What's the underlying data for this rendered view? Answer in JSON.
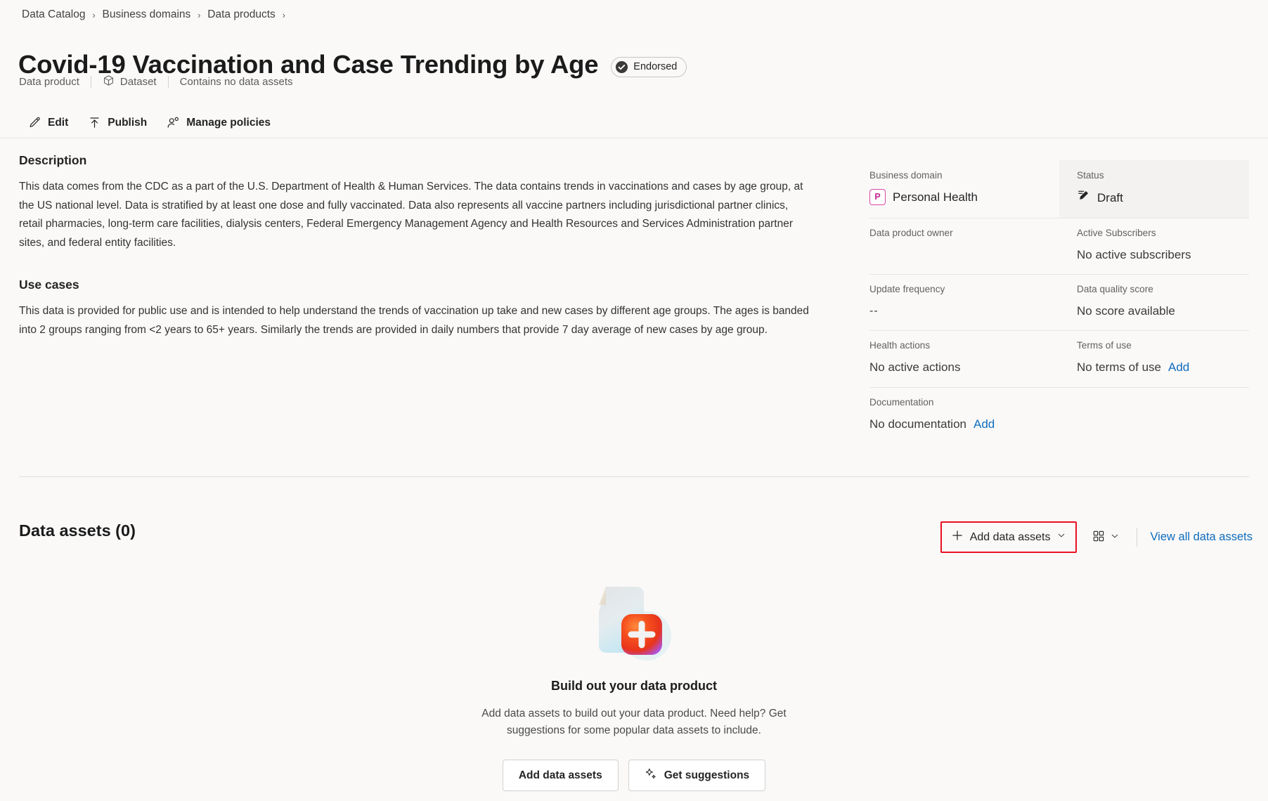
{
  "breadcrumb": {
    "items": [
      {
        "label": "Data Catalog"
      },
      {
        "label": "Business domains"
      },
      {
        "label": "Data products"
      }
    ],
    "separator": "›"
  },
  "header": {
    "title": "Covid-19 Vaccination and Case Trending by Age",
    "endorsed_label": "Endorsed",
    "endorsed_icon": "check-circle-icon",
    "subtitle": {
      "type": "Data product",
      "kind": "Dataset",
      "kind_icon": "cube-icon",
      "assets_status": "Contains no data assets"
    }
  },
  "commandbar": {
    "edit": {
      "label": "Edit",
      "icon": "pencil-icon"
    },
    "publish": {
      "label": "Publish",
      "icon": "upload-arrow-icon"
    },
    "manage_policies": {
      "label": "Manage policies",
      "icon": "person-settings-icon"
    }
  },
  "description": {
    "heading": "Description",
    "body": "This data comes from the CDC as a part of the U.S. Department of Health & Human Services.  The data contains trends in vaccinations and cases by age group, at the US national level. Data is stratified by at least one dose and fully vaccinated. Data also represents all vaccine partners including jurisdictional partner clinics, retail pharmacies, long-term care facilities, dialysis centers, Federal Emergency Management Agency and Health Resources and Services Administration partner sites, and federal entity facilities."
  },
  "use_cases": {
    "heading": "Use cases",
    "body": "This data is provided for public use and is intended to help understand the trends of vaccination up take and new cases by different age groups.  The ages is banded into 2 groups ranging from <2 years to 65+ years.  Similarly the trends are provided in daily numbers that provide 7 day average of new cases by age group."
  },
  "properties": {
    "business_domain": {
      "label": "Business domain",
      "value": "Personal Health",
      "chip": "P",
      "chip_color": "#c2298f"
    },
    "status": {
      "label": "Status",
      "value": "Draft",
      "icon": "edit-filled-icon",
      "highlight_color": "#f3f2f1"
    },
    "data_product_owner": {
      "label": "Data product owner",
      "value": ""
    },
    "active_subscribers": {
      "label": "Active Subscribers",
      "value": "No active subscribers"
    },
    "update_frequency": {
      "label": "Update frequency",
      "value": "--"
    },
    "data_quality_score": {
      "label": "Data quality score",
      "value": "No score available"
    },
    "health_actions": {
      "label": "Health actions",
      "value": "No active actions"
    },
    "terms_of_use": {
      "label": "Terms of use",
      "value": "No terms of use",
      "action": "Add"
    },
    "documentation": {
      "label": "Documentation",
      "value": "No documentation",
      "action": "Add"
    }
  },
  "data_assets": {
    "heading": "Data assets (0)",
    "add_button": {
      "label": "Add data assets",
      "icon": "plus-icon",
      "chevron": "chevron-down-icon",
      "highlight_color": "#e81123"
    },
    "view_toggle": {
      "icon": "grid-view-icon",
      "chevron": "chevron-down-icon"
    },
    "view_all_link": "View all data assets",
    "empty_state": {
      "illustration": "document-add-icon",
      "title": "Build out your data product",
      "description": "Add data assets to build out your data product. Need help? Get suggestions for some popular data assets to include.",
      "primary_button": {
        "label": "Add data assets"
      },
      "secondary_button": {
        "label": "Get suggestions",
        "icon": "sparkle-icon"
      }
    }
  },
  "theme": {
    "accent": "#0f6cbd",
    "background": "#faf9f8",
    "highlight": "#e81123"
  }
}
